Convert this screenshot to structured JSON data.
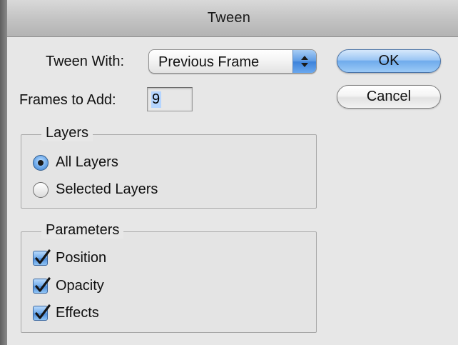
{
  "window": {
    "title": "Tween"
  },
  "tween_with": {
    "label": "Tween With:",
    "value": "Previous Frame",
    "icon": "updown-arrows-icon"
  },
  "frames_to_add": {
    "label": "Frames to Add:",
    "value": "9"
  },
  "buttons": {
    "ok": "OK",
    "cancel": "Cancel"
  },
  "layers": {
    "title": "Layers",
    "options": [
      {
        "label": "All Layers",
        "selected": true
      },
      {
        "label": "Selected Layers",
        "selected": false
      }
    ]
  },
  "parameters": {
    "title": "Parameters",
    "options": [
      {
        "label": "Position",
        "checked": true
      },
      {
        "label": "Opacity",
        "checked": true
      },
      {
        "label": "Effects",
        "checked": true
      }
    ]
  },
  "colors": {
    "accent": "#5c9ae4",
    "window_bg": "#e7e7e7"
  }
}
